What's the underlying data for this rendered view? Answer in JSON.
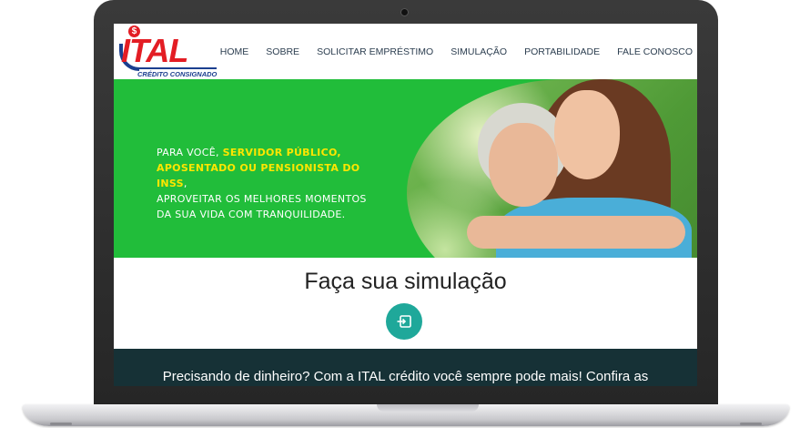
{
  "brand": {
    "name": "ITAL",
    "tagline": "CRÉDITO CONSIGNADO",
    "symbol": "$",
    "colors": {
      "red": "#e31d24",
      "blue": "#1b3f8f"
    }
  },
  "nav": {
    "items": [
      {
        "label": "HOME"
      },
      {
        "label": "SOBRE"
      },
      {
        "label": "SOLICITAR EMPRÉSTIMO"
      },
      {
        "label": "SIMULAÇÃO"
      },
      {
        "label": "PORTABILIDADE"
      },
      {
        "label": "FALE CONOSCO"
      }
    ]
  },
  "hero": {
    "line1_prefix": "PARA VOCÊ, ",
    "highlight1": "SERVIDOR PÚBLICO,",
    "highlight2": "APOSENTADO OU PENSIONISTA DO INSS",
    "line2_suffix": ",",
    "line3": "APROVEITAR OS MELHORES MOMENTOS",
    "line4": "DA SUA VIDA COM TRANQUILIDADE.",
    "colors": {
      "background": "#21bd3a",
      "highlight": "#ffe600"
    }
  },
  "simulation": {
    "title": "Faça sua simulação",
    "button_icon": "sign-in-icon",
    "colors": {
      "button": "#1fa89a"
    }
  },
  "promo": {
    "text": "Precisando de dinheiro? Com a ITAL crédito você sempre pode mais! Confira as",
    "colors": {
      "background": "#163136"
    }
  }
}
